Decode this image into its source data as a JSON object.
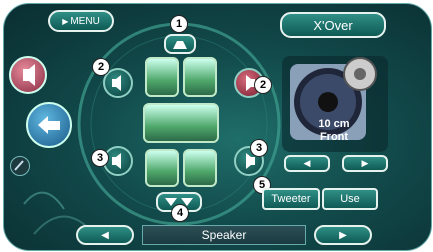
{
  "header": {
    "menu_label": "MENU",
    "xover_label": "X'Over"
  },
  "speaker_panel": {
    "size": "10 cm",
    "position": "Front"
  },
  "tweeter": {
    "label": "Tweeter",
    "value": "Use"
  },
  "footer": {
    "title": "Speaker"
  },
  "markers": {
    "m1": "1",
    "m2a": "2",
    "m2b": "2",
    "m3a": "3",
    "m3b": "3",
    "m4": "4",
    "m5": "5"
  },
  "icons": [
    "menu-icon",
    "center-speaker-icon",
    "speaker-icon",
    "car-seats-icon",
    "woofer-icon",
    "arrow-left-icon",
    "arrow-right-icon",
    "return-icon",
    "tool-icon"
  ],
  "colors": {
    "background": "#124a4b",
    "accent_active": "#c24a5e",
    "seat_green": "#4fa86a",
    "button_border": "#e6f2ee"
  }
}
